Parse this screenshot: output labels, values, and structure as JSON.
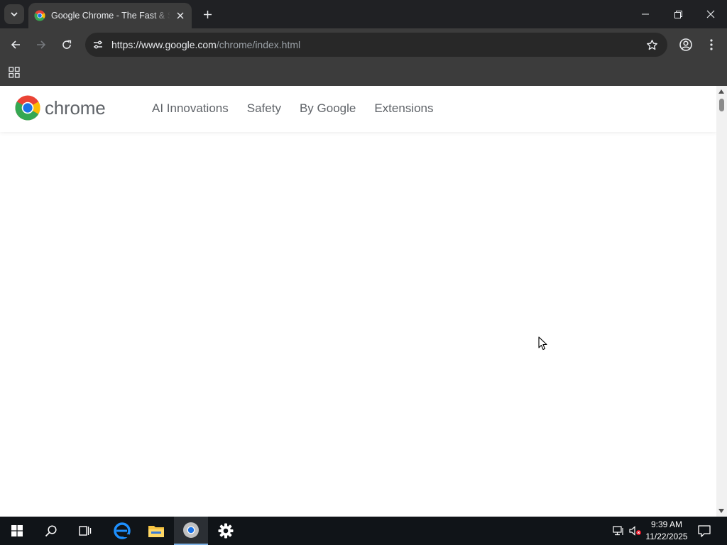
{
  "browser": {
    "tab_title": "Google Chrome - The Fast & Secure Web Browser Built to be Yours",
    "url_host": "https://www.google.com",
    "url_path": "/chrome/index.html"
  },
  "page": {
    "logo_text": "chrome",
    "nav": [
      {
        "label": "AI Innovations"
      },
      {
        "label": "Safety"
      },
      {
        "label": "By Google"
      },
      {
        "label": "Extensions"
      }
    ]
  },
  "taskbar": {
    "time": "9:39 AM",
    "date": "11/22/2025"
  },
  "colors": {
    "chrome_red": "#ea4335",
    "chrome_yellow": "#fbbc04",
    "chrome_green": "#34a853",
    "chrome_blue": "#1a73e8"
  },
  "icons": [
    "tab-search-icon",
    "chrome-favicon-icon",
    "close-icon",
    "plus-icon",
    "minimize-icon",
    "restore-icon",
    "back-arrow-icon",
    "forward-arrow-icon",
    "reload-icon",
    "site-info-icon",
    "star-icon",
    "profile-icon",
    "kebab-menu-icon",
    "apps-grid-icon",
    "windows-start-icon",
    "search-icon",
    "task-view-icon",
    "edge-icon",
    "file-explorer-icon",
    "chrome-icon",
    "settings-gear-icon",
    "network-icon",
    "volume-muted-icon",
    "notification-icon"
  ]
}
